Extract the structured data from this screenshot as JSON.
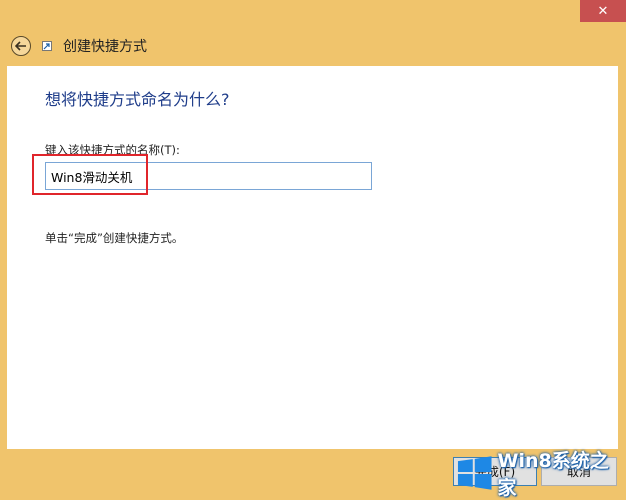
{
  "window": {
    "title": "创建快捷方式",
    "close_glyph": "✕"
  },
  "page": {
    "heading": "想将快捷方式命名为什么?",
    "name_label": "键入该快捷方式的名称(T):",
    "name_value": "Win8滑动关机",
    "finish_hint": "单击“完成”创建快捷方式。"
  },
  "buttons": {
    "finish_label": "完成(F)",
    "cancel_label": "取消"
  },
  "icons": {
    "back": "back-arrow-icon",
    "app": "shortcut-icon",
    "watermark": "windows-logo-icon"
  },
  "colors": {
    "window_frame": "#f0c46c",
    "heading": "#1f3d8a",
    "highlight": "#e0252b",
    "input_border": "#7aa6d6"
  },
  "watermark": {
    "text": "Win8系统之家"
  }
}
